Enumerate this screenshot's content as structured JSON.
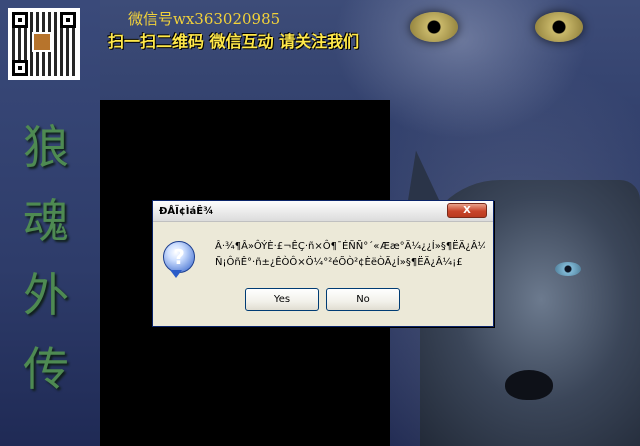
{
  "banner": {
    "wechat_id": "微信号wx363020985",
    "scan_text": "扫一扫二维码 微信互动 请关注我们"
  },
  "game_title": [
    "狼",
    "魂",
    "外",
    "传"
  ],
  "dialog": {
    "title": "ÐÅÏ¢ÌáÊ¾",
    "close_label": "X",
    "icon_glyph": "?",
    "message_lines": [
      "Â·¾¶Â»ÔÝÈ·£¬ÊÇ·ñ×Ô¶¯ÉÑÑ°´«Ææ°Ä¼¿¿Í»§¶ËÄ¿Â¼£¿",
      "Ñ¡ÔñÊ°·ñ±¿ÊÒÔ×Ö¼°²éÕÒ²¢ÈëÒÃ¿Í»§¶ËÄ¿Â¼¡£"
    ],
    "yes_label": "Yes",
    "no_label": "No"
  }
}
